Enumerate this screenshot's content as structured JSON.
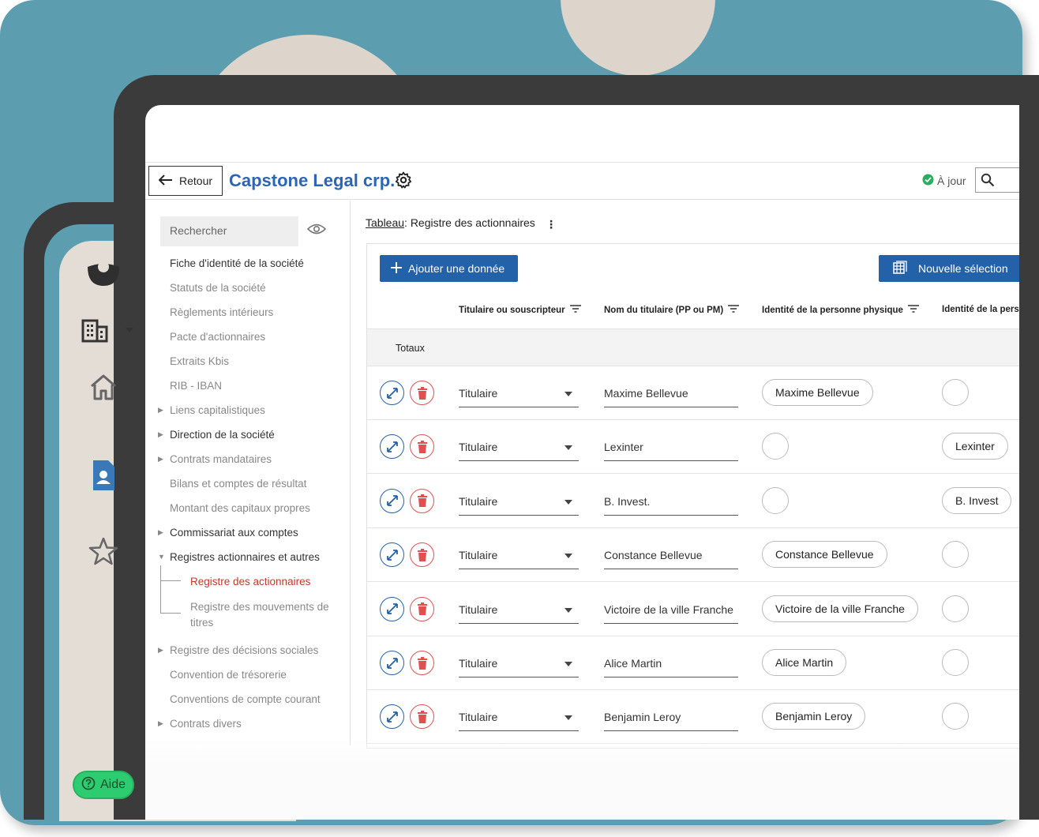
{
  "header": {
    "back_label": "Retour",
    "company_name": "Capstone Legal crp.",
    "status_text": "À jour"
  },
  "rail": {
    "help_label": "Aide"
  },
  "sidebar": {
    "search_placeholder": "Rechercher",
    "items": [
      {
        "label": "Fiche d'identité de la société",
        "tone": "dark"
      },
      {
        "label": "Statuts de la société",
        "tone": "muted"
      },
      {
        "label": "Règlements intérieurs",
        "tone": "muted"
      },
      {
        "label": "Pacte d'actionnaires",
        "tone": "muted"
      },
      {
        "label": "Extraits Kbis",
        "tone": "muted"
      },
      {
        "label": "RIB - IBAN",
        "tone": "muted"
      },
      {
        "label": "Liens capitalistiques",
        "tone": "muted"
      },
      {
        "label": "Direction de la société",
        "tone": "dark"
      },
      {
        "label": "Contrats mandataires",
        "tone": "muted"
      },
      {
        "label": "Bilans et comptes de résultat",
        "tone": "muted"
      },
      {
        "label": "Montant des capitaux propres",
        "tone": "muted"
      },
      {
        "label": "Commissariat aux comptes",
        "tone": "dark"
      },
      {
        "label": "Registres actionnaires et autres",
        "tone": "dark"
      },
      {
        "label": "Registre des actionnaires",
        "tone": "active"
      },
      {
        "label": "Registre des mouvements de titres",
        "tone": "muted"
      },
      {
        "label": "Registre des décisions sociales",
        "tone": "muted"
      },
      {
        "label": "Convention de trésorerie",
        "tone": "muted"
      },
      {
        "label": "Conventions de compte courant",
        "tone": "muted"
      },
      {
        "label": "Contrats divers",
        "tone": "muted"
      }
    ]
  },
  "main": {
    "crumb_prefix": "Tableau",
    "crumb_title": ": Registre des actionnaires",
    "add_button": "Ajouter une donnée",
    "new_selection_button": "Nouvelle sélection",
    "columns": [
      "Titulaire ou souscripteur",
      "Nom du titulaire (PP ou PM)",
      "Identité de la personne physique",
      "Identité de la pers"
    ],
    "totals_label": "Totaux",
    "rows": [
      {
        "type": "Titulaire",
        "name": "Maxime Bellevue",
        "pp": "Maxime Bellevue",
        "pm": ""
      },
      {
        "type": "Titulaire",
        "name": "Lexinter",
        "pp": "",
        "pm": "Lexinter"
      },
      {
        "type": "Titulaire",
        "name": "B. Invest.",
        "pp": "",
        "pm": "B. Invest"
      },
      {
        "type": "Titulaire",
        "name": "Constance Bellevue",
        "pp": "Constance Bellevue",
        "pm": ""
      },
      {
        "type": "Titulaire",
        "name": "Victoire de la ville Franche",
        "pp": "Victoire de la ville Franche",
        "pm": ""
      },
      {
        "type": "Titulaire",
        "name": "Alice Martin",
        "pp": "Alice Martin",
        "pm": ""
      },
      {
        "type": "Titulaire",
        "name": "Benjamin Leroy",
        "pp": "Benjamin Leroy",
        "pm": ""
      }
    ]
  },
  "colors": {
    "teal_bg": "#5d9db0",
    "beige": "#e4ddd6",
    "frame": "#3b3b3b",
    "brand_blue": "#2361a8",
    "company_blue": "#2d64b3",
    "delete_red": "#e05050",
    "active_red": "#c0392b",
    "help_green": "#2ecc71"
  }
}
